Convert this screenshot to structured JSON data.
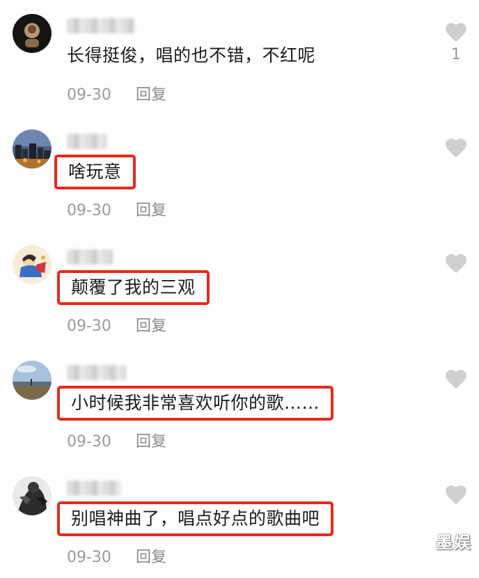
{
  "comments": [
    {
      "text": "长得挺俊，唱的也不错，不红呢",
      "date": "09-30",
      "reply": "回复",
      "likes": "1",
      "highlighted": false
    },
    {
      "text": "啥玩意",
      "date": "09-30",
      "reply": "回复",
      "likes": "",
      "highlighted": true
    },
    {
      "text": "颠覆了我的三观",
      "date": "09-30",
      "reply": "回复",
      "likes": "",
      "highlighted": true
    },
    {
      "text": "小时候我非常喜欢听你的歌……",
      "date": "09-30",
      "reply": "回复",
      "likes": "",
      "highlighted": true
    },
    {
      "text": "别唱神曲了，唱点好点的歌曲吧",
      "date": "09-30",
      "reply": "回复",
      "likes": "",
      "highlighted": true
    }
  ],
  "colors": {
    "highlight_border": "#e5291f",
    "like_icon": "#cfcfcf",
    "meta_text": "#9a9a9a"
  },
  "icons": {
    "like": "heart-icon"
  },
  "watermark": "墨娱"
}
